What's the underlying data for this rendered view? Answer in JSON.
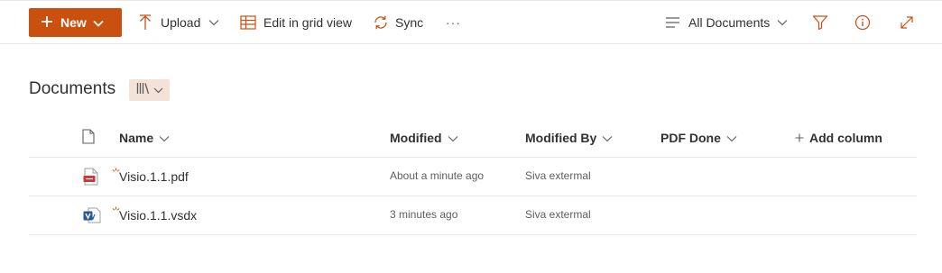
{
  "toolbar": {
    "new_label": "New",
    "upload_label": "Upload",
    "grid_label": "Edit in grid view",
    "sync_label": "Sync",
    "more_label": "···",
    "view_label": "All Documents",
    "icons": [
      "plus-icon",
      "upload-arrow-icon",
      "grid-view-icon",
      "sync-icon",
      "more-icon",
      "list-view-icon",
      "filter-icon",
      "info-icon",
      "expand-icon"
    ]
  },
  "library": {
    "title": "Documents"
  },
  "columns": {
    "name": "Name",
    "modified": "Modified",
    "modified_by": "Modified By",
    "pdf_done": "PDF Done",
    "add_column": "Add column"
  },
  "files": [
    {
      "name": "Visio.1.1.pdf",
      "modified": "About a minute ago",
      "modified_by": "Siva extermal",
      "type_icon": "pdf-file-icon"
    },
    {
      "name": "Visio.1.1.vsdx",
      "modified": "3 minutes ago",
      "modified_by": "Siva extermal",
      "type_icon": "visio-file-icon"
    }
  ],
  "colors": {
    "accent": "#ca5010",
    "view_button_bg": "#f3e2d8",
    "text": "#323130",
    "subtle_text": "#605e5c",
    "divider": "#edebe9"
  }
}
